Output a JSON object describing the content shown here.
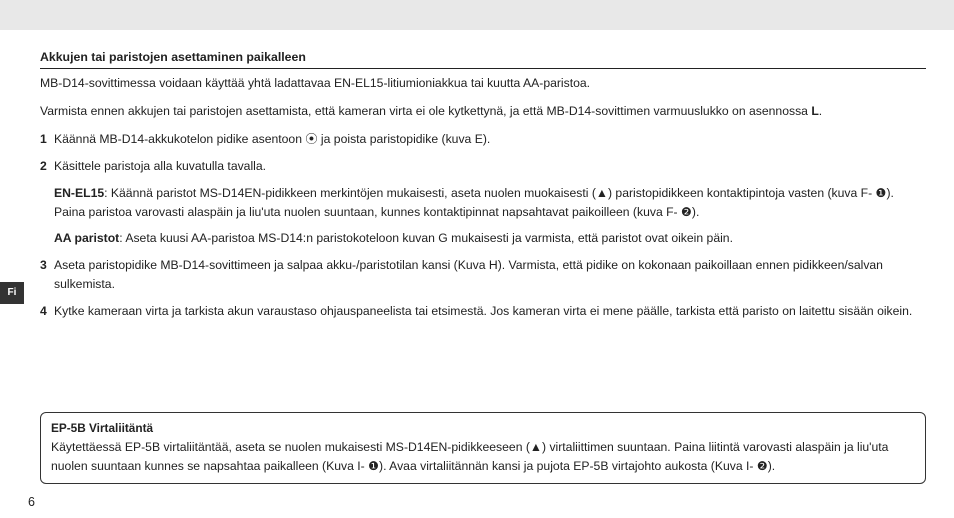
{
  "lang_tab": "Fi",
  "heading": "Akkujen tai paristojen asettaminen paikalleen",
  "intro1": "MB-D14-sovittimessa voidaan käyttää yhtä ladattavaa EN-EL15-litiumioniakkua tai kuutta AA-paristoa.",
  "intro2_a": "Varmista ennen akkujen tai paristojen asettamista, että kameran virta ei ole kytkettynä, ja että MB-D14-sovittimen varmuuslukko on asennossa ",
  "intro2_b": "L",
  "intro2_c": ".",
  "steps": {
    "s1": {
      "n": "1",
      "t": "Käännä MB-D14-akkukotelon pidike asentoon ⦿ ja poista paristopidike (kuva E)."
    },
    "s2": {
      "n": "2",
      "t": "Käsittele paristoja alla kuvatulla tavalla."
    },
    "s2a_label": "EN-EL15",
    "s2a_text": ": Käännä paristot MS-D14EN-pidikkeen merkintöjen mukaisesti, aseta nuolen muokaisesti (▲) paristopidikkeen kontaktipintoja vasten (kuva F- ❶). Paina paristoa varovasti alaspäin ja liu'uta nuolen suuntaan, kunnes kontaktipinnat napsahtavat paikoilleen (kuva F- ❷).",
    "s2b_label": "AA paristot",
    "s2b_text": ": Aseta kuusi AA-paristoa MS-D14:n paristokoteloon kuvan G mukaisesti ja varmista, että paristot ovat oikein päin.",
    "s3": {
      "n": "3",
      "t": "Aseta paristopidike MB-D14-sovittimeen ja salpaa akku-/paristotilan kansi (Kuva H). Varmista, että pidike on kokonaan paikoillaan ennen pidikkeen/salvan sulkemista."
    },
    "s4": {
      "n": "4",
      "t": "Kytke kameraan virta ja tarkista akun varaustaso ohjauspaneelista tai etsimestä. Jos kameran virta ei mene päälle, tarkista että paristo on laitettu sisään oikein."
    }
  },
  "box": {
    "title": "EP-5B Virtaliitäntä",
    "text": "Käytettäessä EP-5B virtaliitäntää, aseta se nuolen mukaisesti MS-D14EN-pidikkeeseen (▲) virtaliittimen suuntaan. Paina liitintä varovasti alaspäin ja liu'uta nuolen suuntaan kunnes se napsahtaa paikalleen (Kuva I- ❶). Avaa virtaliitännän kansi ja pujota EP-5B virtajohto aukosta (Kuva I- ❷)."
  },
  "page_number": "6"
}
